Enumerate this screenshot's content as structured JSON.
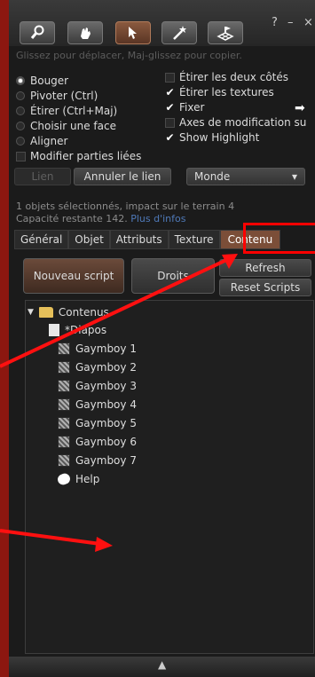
{
  "window": {
    "help": "?",
    "minimize": "–",
    "close": "×"
  },
  "hint": "Glissez pour déplacer, Maj-glissez pour copier.",
  "modes": [
    {
      "label": "Bouger",
      "selected": true
    },
    {
      "label": "Pivoter (Ctrl)",
      "selected": false
    },
    {
      "label": "Étirer (Ctrl+Maj)",
      "selected": false
    },
    {
      "label": "Choisir une face",
      "selected": false
    },
    {
      "label": "Aligner",
      "selected": false
    }
  ],
  "modifier": {
    "label": "Modifier parties liées",
    "checked": false
  },
  "options": [
    {
      "label": "Étirer les deux côtés",
      "checked": false
    },
    {
      "label": "Étirer les textures",
      "checked": true
    },
    {
      "label": "Fixer",
      "checked": true
    },
    {
      "label": "Axes de modification su",
      "checked": false
    },
    {
      "label": "Show Highlight",
      "checked": true
    }
  ],
  "link_buttons": {
    "link": "Lien",
    "unlink": "Annuler le lien"
  },
  "grid": {
    "value": "Monde"
  },
  "selection_info": {
    "line1": "1 objets sélectionnés, impact sur le terrain 4",
    "line2": "Capacité restante 142.",
    "more_link": "Plus d'infos"
  },
  "tabs": [
    "Général",
    "Objet",
    "Attributs",
    "Texture",
    "Contenu"
  ],
  "content_buttons": {
    "new_script": "Nouveau script",
    "permissions": "Droits",
    "refresh": "Refresh",
    "reset_scripts": "Reset Scripts"
  },
  "tree": {
    "root": "Contenus",
    "items": [
      {
        "label": "*Diapos",
        "icon": "notecard-icon"
      },
      {
        "label": "Gaymboy 1",
        "icon": "texture-icon"
      },
      {
        "label": "Gaymboy 2",
        "icon": "texture-icon"
      },
      {
        "label": "Gaymboy 3",
        "icon": "texture-icon"
      },
      {
        "label": "Gaymboy 4",
        "icon": "texture-icon"
      },
      {
        "label": "Gaymboy 5",
        "icon": "texture-icon"
      },
      {
        "label": "Gaymboy 6",
        "icon": "texture-icon"
      },
      {
        "label": "Gaymboy 7",
        "icon": "texture-icon"
      },
      {
        "label": "Help",
        "icon": "landmark-icon"
      }
    ]
  },
  "colors": {
    "accent": "#7b4e38",
    "highlight": "#ff0000",
    "link": "#4f79b8"
  }
}
